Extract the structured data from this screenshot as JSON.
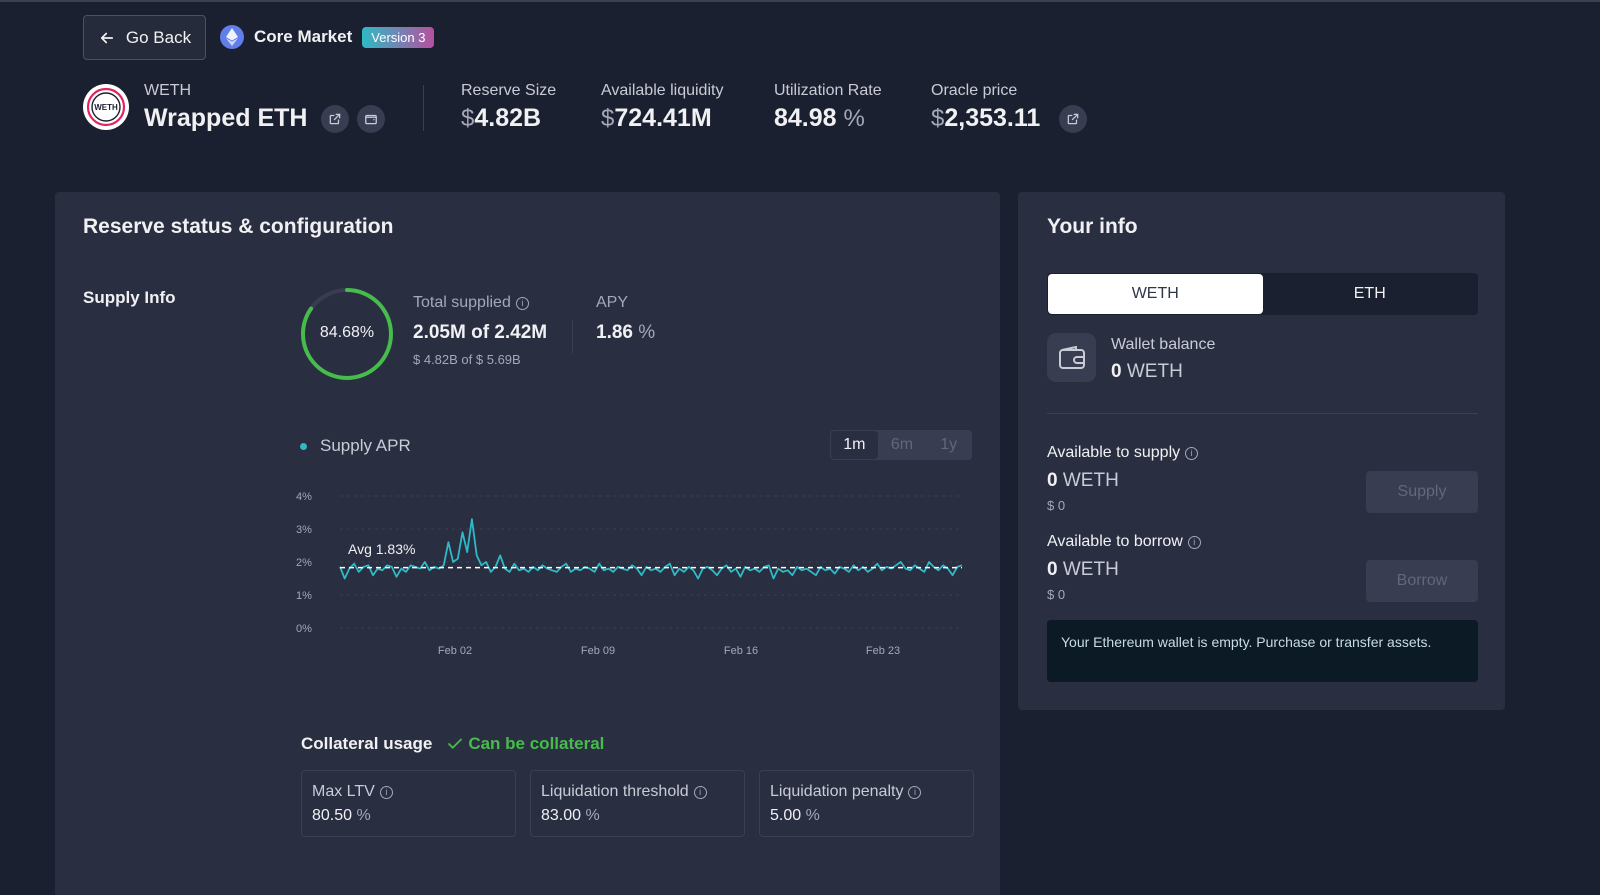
{
  "header": {
    "back_label": "Go Back",
    "market_name": "Core Market",
    "version_badge": "Version 3"
  },
  "asset": {
    "symbol": "WETH",
    "name": "Wrapped ETH",
    "logo_text": "WETH"
  },
  "stats": [
    {
      "label": "Reserve Size",
      "prefix": "$",
      "value": "4.82B",
      "suffix": ""
    },
    {
      "label": "Available liquidity",
      "prefix": "$",
      "value": "724.41M",
      "suffix": ""
    },
    {
      "label": "Utilization Rate",
      "prefix": "",
      "value": "84.98",
      "suffix": "%"
    },
    {
      "label": "Oracle price",
      "prefix": "$",
      "value": "2,353.11",
      "suffix": ""
    }
  ],
  "reserve": {
    "title": "Reserve status & configuration",
    "supply_info_label": "Supply Info",
    "ring_percent_text": "84.68%",
    "ring_fraction": 0.8468,
    "total_supplied_label": "Total supplied",
    "total_supplied_value": "2.05M of 2.42M",
    "total_supplied_usd": "$ 4.82B of $ 5.69B",
    "apy_label": "APY",
    "apy_value": "1.86",
    "apy_unit": "%"
  },
  "chart_data": {
    "type": "line",
    "legend": "Supply APR",
    "ranges": [
      "1m",
      "6m",
      "1y"
    ],
    "active_range": "1m",
    "y_ticks": [
      "4%",
      "3%",
      "2%",
      "1%",
      "0%"
    ],
    "x_ticks": [
      "Feb 02",
      "Feb 09",
      "Feb 16",
      "Feb 23"
    ],
    "ylim": [
      0,
      4
    ],
    "avg_label": "Avg 1.83%",
    "avg_value": 1.83,
    "series": [
      {
        "values": [
          1.85,
          1.5,
          1.8,
          1.95,
          1.7,
          1.85,
          1.9,
          1.6,
          1.8,
          1.75,
          1.9,
          1.85,
          1.55,
          1.8,
          1.7,
          1.9,
          1.85,
          1.8,
          2.0,
          1.75,
          1.85,
          1.8,
          1.9,
          2.6,
          2.0,
          2.1,
          2.9,
          2.3,
          3.3,
          2.2,
          1.9,
          2.0,
          1.7,
          1.85,
          2.2,
          1.8,
          1.7,
          1.95,
          1.75,
          1.8,
          1.7,
          1.85,
          1.75,
          1.9,
          1.8,
          1.75,
          1.7,
          1.85,
          1.95,
          1.7,
          1.8,
          1.75,
          1.85,
          1.8,
          1.7,
          1.95,
          1.75,
          1.8,
          1.7,
          1.85,
          1.8,
          1.75,
          1.9,
          1.8,
          1.6,
          1.85,
          1.75,
          1.8,
          1.7,
          1.85,
          1.95,
          1.6,
          1.8,
          1.7,
          1.85,
          1.75,
          1.5,
          1.8,
          1.85,
          1.75,
          1.6,
          1.8,
          1.9,
          1.7,
          1.8,
          1.55,
          1.85,
          1.75,
          1.8,
          1.7,
          1.85,
          1.9,
          1.5,
          1.8,
          1.7,
          1.75,
          1.6,
          1.85,
          1.75,
          1.8,
          1.7,
          1.6,
          1.85,
          1.75,
          1.8,
          1.65,
          1.85,
          1.8,
          1.7,
          1.9,
          1.75,
          1.85,
          1.7,
          1.8,
          1.95,
          1.75,
          1.85,
          1.8,
          1.9,
          2.0,
          1.8,
          1.75,
          1.9,
          1.8,
          1.7,
          2.0,
          1.85,
          1.75,
          1.9,
          1.8,
          1.6,
          1.85,
          1.9
        ]
      }
    ]
  },
  "collateral": {
    "title": "Collateral usage",
    "status": "Can be collateral",
    "params": [
      {
        "label": "Max LTV",
        "value": "80.50",
        "unit": "%"
      },
      {
        "label": "Liquidation threshold",
        "value": "83.00",
        "unit": "%"
      },
      {
        "label": "Liquidation penalty",
        "value": "5.00",
        "unit": "%"
      }
    ]
  },
  "your_info": {
    "title": "Your info",
    "toggle": [
      "WETH",
      "ETH"
    ],
    "wallet_label": "Wallet balance",
    "wallet_amount": "0",
    "wallet_unit": "WETH",
    "supply_label": "Available to supply",
    "supply_amount": "0",
    "supply_unit": "WETH",
    "supply_usd": "$ 0",
    "supply_button": "Supply",
    "borrow_label": "Available to borrow",
    "borrow_amount": "0",
    "borrow_unit": "WETH",
    "borrow_usd": "$ 0",
    "borrow_button": "Borrow",
    "notice": "Your Ethereum wallet is empty. Purchase or transfer assets."
  },
  "colors": {
    "background": "#1b2030",
    "panel": "#292e41",
    "accent": "#2ebac6",
    "success": "#46bc4b"
  }
}
